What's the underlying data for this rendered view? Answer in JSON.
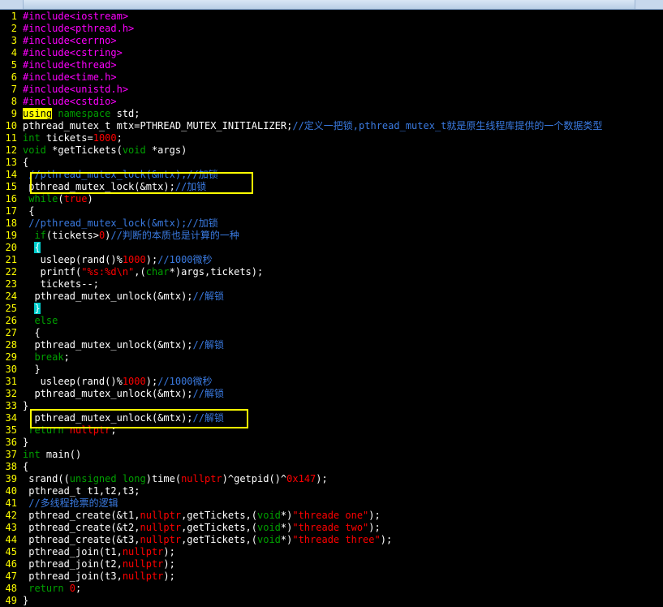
{
  "colors": {
    "background": "#000000",
    "line_number": "#ffff00",
    "plain": "#ffffff",
    "preprocessor": "#ff00ff",
    "keyword": "#00a000",
    "number_string": "#ff0000",
    "comment": "#3a7ae0",
    "highlight_box": "#ffff00"
  },
  "editor": {
    "lines": [
      {
        "n": "1",
        "tokens": [
          {
            "t": "#include<iostream>",
            "c": "pre"
          }
        ]
      },
      {
        "n": "2",
        "tokens": [
          {
            "t": "#include<pthread.h>",
            "c": "pre"
          }
        ]
      },
      {
        "n": "3",
        "tokens": [
          {
            "t": "#include<cerrno>",
            "c": "pre"
          }
        ]
      },
      {
        "n": "4",
        "tokens": [
          {
            "t": "#include<cstring>",
            "c": "pre"
          }
        ]
      },
      {
        "n": "5",
        "tokens": [
          {
            "t": "#include<thread>",
            "c": "pre"
          }
        ]
      },
      {
        "n": "6",
        "tokens": [
          {
            "t": "#include<time.h>",
            "c": "pre"
          }
        ]
      },
      {
        "n": "7",
        "tokens": [
          {
            "t": "#include<unistd.h>",
            "c": "pre"
          }
        ]
      },
      {
        "n": "8",
        "tokens": [
          {
            "t": "#include<cstdio>",
            "c": "pre"
          }
        ]
      },
      {
        "n": "9",
        "tokens": [
          {
            "t": "using",
            "c": "hl"
          },
          {
            "t": " namespace",
            "c": "kw"
          },
          {
            "t": " std;",
            "c": "plain"
          }
        ]
      },
      {
        "n": "10",
        "tokens": [
          {
            "t": "pthread_mutex_t mtx=PTHREAD_MUTEX_INITIALIZER;",
            "c": "plain"
          },
          {
            "t": "//定义一把锁,pthread_mutex_t就是原生线程库提供的一个数据类型",
            "c": "cmt"
          }
        ]
      },
      {
        "n": "11",
        "tokens": [
          {
            "t": "int",
            "c": "type"
          },
          {
            "t": " tickets=",
            "c": "plain"
          },
          {
            "t": "1000",
            "c": "num"
          },
          {
            "t": ";",
            "c": "plain"
          }
        ]
      },
      {
        "n": "12",
        "tokens": [
          {
            "t": "void",
            "c": "type"
          },
          {
            "t": " *getTickets(",
            "c": "plain"
          },
          {
            "t": "void",
            "c": "type"
          },
          {
            "t": " *args)",
            "c": "plain"
          }
        ]
      },
      {
        "n": "13",
        "tokens": [
          {
            "t": "{",
            "c": "plain"
          }
        ]
      },
      {
        "n": "14",
        "tokens": [
          {
            "t": " //pthread_mutex_lock(&mtx);//加锁",
            "c": "cmt"
          }
        ]
      },
      {
        "n": "15",
        "tokens": [
          {
            "t": " pthread_mutex_lock(&mtx);",
            "c": "plain"
          },
          {
            "t": "//加锁",
            "c": "cmt"
          }
        ]
      },
      {
        "n": "16",
        "tokens": [
          {
            "t": " while",
            "c": "kw"
          },
          {
            "t": "(",
            "c": "plain"
          },
          {
            "t": "true",
            "c": "num"
          },
          {
            "t": ")",
            "c": "plain"
          }
        ]
      },
      {
        "n": "17",
        "tokens": [
          {
            "t": " {",
            "c": "plain"
          }
        ]
      },
      {
        "n": "18",
        "tokens": [
          {
            "t": " //pthread_mutex_lock(&mtx);//加锁",
            "c": "cmt"
          }
        ]
      },
      {
        "n": "19",
        "tokens": [
          {
            "t": "  if",
            "c": "kw"
          },
          {
            "t": "(tickets>",
            "c": "plain"
          },
          {
            "t": "0",
            "c": "num"
          },
          {
            "t": ")",
            "c": "plain"
          },
          {
            "t": "//判断的本质也是计算的一种",
            "c": "cmt"
          }
        ]
      },
      {
        "n": "20",
        "tokens": [
          {
            "t": "  ",
            "c": "plain"
          },
          {
            "t": "{",
            "c": "cur"
          }
        ]
      },
      {
        "n": "21",
        "tokens": [
          {
            "t": "   usleep(rand()%",
            "c": "plain"
          },
          {
            "t": "1000",
            "c": "num"
          },
          {
            "t": ");",
            "c": "plain"
          },
          {
            "t": "//1000微秒",
            "c": "cmt"
          }
        ]
      },
      {
        "n": "22",
        "tokens": [
          {
            "t": "   printf(",
            "c": "plain"
          },
          {
            "t": "\"%s:%d\\n\"",
            "c": "str"
          },
          {
            "t": ",(",
            "c": "plain"
          },
          {
            "t": "char",
            "c": "type"
          },
          {
            "t": "*)args,tickets);",
            "c": "plain"
          }
        ]
      },
      {
        "n": "23",
        "tokens": [
          {
            "t": "   tickets--;",
            "c": "plain"
          }
        ]
      },
      {
        "n": "24",
        "tokens": [
          {
            "t": "  pthread_mutex_unlock(&mtx);",
            "c": "plain"
          },
          {
            "t": "//解锁",
            "c": "cmt"
          }
        ]
      },
      {
        "n": "25",
        "tokens": [
          {
            "t": "  ",
            "c": "plain"
          },
          {
            "t": "}",
            "c": "cur"
          }
        ]
      },
      {
        "n": "26",
        "tokens": [
          {
            "t": "  else",
            "c": "kw"
          }
        ]
      },
      {
        "n": "27",
        "tokens": [
          {
            "t": "  {",
            "c": "plain"
          }
        ]
      },
      {
        "n": "28",
        "tokens": [
          {
            "t": "  pthread_mutex_unlock(&mtx);",
            "c": "plain"
          },
          {
            "t": "//解锁",
            "c": "cmt"
          }
        ]
      },
      {
        "n": "29",
        "tokens": [
          {
            "t": "  break",
            "c": "kw"
          },
          {
            "t": ";",
            "c": "plain"
          }
        ]
      },
      {
        "n": "30",
        "tokens": [
          {
            "t": "  }",
            "c": "plain"
          }
        ]
      },
      {
        "n": "31",
        "tokens": [
          {
            "t": "   usleep(rand()%",
            "c": "plain"
          },
          {
            "t": "1000",
            "c": "num"
          },
          {
            "t": ");",
            "c": "plain"
          },
          {
            "t": "//1000微秒",
            "c": "cmt"
          }
        ]
      },
      {
        "n": "32",
        "tokens": [
          {
            "t": "  pthread_mutex_unlock(&mtx);",
            "c": "plain"
          },
          {
            "t": "//解锁",
            "c": "cmt"
          }
        ]
      },
      {
        "n": "33",
        "tokens": [
          {
            "t": "}",
            "c": "plain"
          }
        ]
      },
      {
        "n": "34",
        "tokens": [
          {
            "t": "  pthread_mutex_unlock(&mtx);",
            "c": "plain"
          },
          {
            "t": "//解锁",
            "c": "cmt"
          }
        ]
      },
      {
        "n": "35",
        "tokens": [
          {
            "t": " return",
            "c": "kw"
          },
          {
            "t": " nullptr",
            "c": "num"
          },
          {
            "t": ";",
            "c": "plain"
          }
        ]
      },
      {
        "n": "36",
        "tokens": [
          {
            "t": "}",
            "c": "plain"
          }
        ]
      },
      {
        "n": "37",
        "tokens": [
          {
            "t": "int",
            "c": "type"
          },
          {
            "t": " main()",
            "c": "plain"
          }
        ]
      },
      {
        "n": "38",
        "tokens": [
          {
            "t": "{",
            "c": "plain"
          }
        ]
      },
      {
        "n": "39",
        "tokens": [
          {
            "t": " srand((",
            "c": "plain"
          },
          {
            "t": "unsigned long",
            "c": "type"
          },
          {
            "t": ")time(",
            "c": "plain"
          },
          {
            "t": "nullptr",
            "c": "num"
          },
          {
            "t": ")^getpid()^",
            "c": "plain"
          },
          {
            "t": "0x147",
            "c": "num"
          },
          {
            "t": ");",
            "c": "plain"
          }
        ]
      },
      {
        "n": "40",
        "tokens": [
          {
            "t": " pthread_t t1,t2,t3;",
            "c": "plain"
          }
        ]
      },
      {
        "n": "41",
        "tokens": [
          {
            "t": " //多线程抢票的逻辑",
            "c": "cmt"
          }
        ]
      },
      {
        "n": "42",
        "tokens": [
          {
            "t": " pthread_create(&t1,",
            "c": "plain"
          },
          {
            "t": "nullptr",
            "c": "num"
          },
          {
            "t": ",getTickets,(",
            "c": "plain"
          },
          {
            "t": "void",
            "c": "type"
          },
          {
            "t": "*)",
            "c": "plain"
          },
          {
            "t": "\"threade one\"",
            "c": "str"
          },
          {
            "t": ");",
            "c": "plain"
          }
        ]
      },
      {
        "n": "43",
        "tokens": [
          {
            "t": " pthread_create(&t2,",
            "c": "plain"
          },
          {
            "t": "nullptr",
            "c": "num"
          },
          {
            "t": ",getTickets,(",
            "c": "plain"
          },
          {
            "t": "void",
            "c": "type"
          },
          {
            "t": "*)",
            "c": "plain"
          },
          {
            "t": "\"threade two\"",
            "c": "str"
          },
          {
            "t": ");",
            "c": "plain"
          }
        ]
      },
      {
        "n": "44",
        "tokens": [
          {
            "t": " pthread_create(&t3,",
            "c": "plain"
          },
          {
            "t": "nullptr",
            "c": "num"
          },
          {
            "t": ",getTickets,(",
            "c": "plain"
          },
          {
            "t": "void",
            "c": "type"
          },
          {
            "t": "*)",
            "c": "plain"
          },
          {
            "t": "\"threade three\"",
            "c": "str"
          },
          {
            "t": ");",
            "c": "plain"
          }
        ]
      },
      {
        "n": "45",
        "tokens": [
          {
            "t": " pthread_join(t1,",
            "c": "plain"
          },
          {
            "t": "nullptr",
            "c": "num"
          },
          {
            "t": ");",
            "c": "plain"
          }
        ]
      },
      {
        "n": "46",
        "tokens": [
          {
            "t": " pthread_join(t2,",
            "c": "plain"
          },
          {
            "t": "nullptr",
            "c": "num"
          },
          {
            "t": ");",
            "c": "plain"
          }
        ]
      },
      {
        "n": "47",
        "tokens": [
          {
            "t": " pthread_join(t3,",
            "c": "plain"
          },
          {
            "t": "nullptr",
            "c": "num"
          },
          {
            "t": ");",
            "c": "plain"
          }
        ]
      },
      {
        "n": "48",
        "tokens": [
          {
            "t": " return",
            "c": "kw"
          },
          {
            "t": " 0",
            "c": "num"
          },
          {
            "t": ";",
            "c": "plain"
          }
        ]
      },
      {
        "n": "49",
        "tokens": [
          {
            "t": "}",
            "c": "plain"
          }
        ]
      }
    ]
  }
}
